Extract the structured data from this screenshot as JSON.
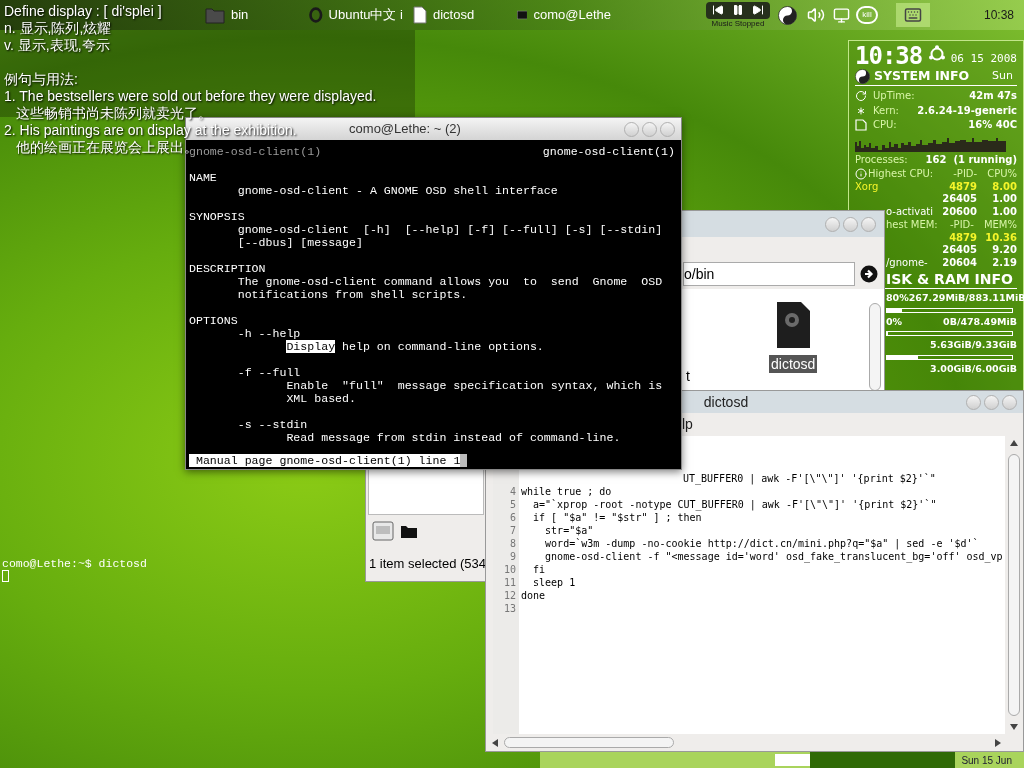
{
  "top_panel": {
    "tasks": [
      {
        "kind": "folder",
        "label": "bin"
      },
      {
        "kind": "browser",
        "label": "Ubuntu中文 i"
      },
      {
        "kind": "document",
        "label": "dictosd"
      },
      {
        "kind": "terminal",
        "label": "como@Lethe"
      }
    ],
    "media_status": "Music Stopped",
    "kill_label": "kill",
    "clock": "10:38"
  },
  "osd": {
    "title": "Define display : [ di'splei ]",
    "senses": [
      "n. 显示,陈列,炫耀",
      "v. 显示,表现,夸示"
    ],
    "examples_heading": "例句与用法:",
    "examples": [
      {
        "en": "1. The bestsellers were sold out before they were displayed.",
        "zh": "这些畅销书尚未陈列就卖光了。"
      },
      {
        "en": "2. His paintings are on display at the exhibition.",
        "zh": "他的绘画正在展览会上展出。"
      }
    ]
  },
  "conky": {
    "time": "10:38",
    "date": "06 15 2008",
    "title": "SYSTEM INFO",
    "day": "Sun",
    "stats": [
      {
        "kind": "uptime",
        "label": "UpTime:",
        "value": "42m 47s"
      },
      {
        "kind": "kernel",
        "label": "Kern:",
        "value": "2.6.24-19-generic"
      },
      {
        "kind": "cpu",
        "label": "CPU:",
        "value": "16% 40C"
      }
    ],
    "processes_label": "Processes:",
    "processes_value": "162  (1 running)",
    "cpu_table": {
      "kind": "full",
      "heading": "Highest CPU:",
      "columns": [
        "-PID-",
        "CPU%"
      ],
      "rows": [
        {
          "kind": "full",
          "name": "Xorg",
          "pid": "4879",
          "value": "8.00",
          "color": "#f5f52a"
        },
        {
          "kind": "partial",
          "pid": "26405",
          "value": "1.00",
          "color": "#ffffff"
        },
        {
          "kind": "partial",
          "name": "o-activati",
          "pid": "20600",
          "value": "1.00",
          "color": "#ffffff"
        }
      ]
    },
    "mem_table": {
      "kind": "partial",
      "heading": "hest MEM:",
      "columns": [
        "-PID-",
        "MEM%"
      ],
      "rows": [
        {
          "kind": "partial",
          "pid": "4879",
          "value": "10.36",
          "color": "#f5f52a"
        },
        {
          "kind": "partial",
          "pid": "26405",
          "value": "9.20",
          "color": "#ffffff"
        },
        {
          "kind": "partial",
          "name": "/gnome-",
          "pid": "20604",
          "value": "2.19",
          "color": "#ffffff"
        }
      ]
    },
    "disk_title": "ISK & RAM INFO",
    "disks": [
      {
        "label": "80%",
        "value": "267.29MiB/883.11MiB",
        "level": 0.12
      },
      {
        "label": "0%",
        "value": "0B/478.49MiB",
        "level": 0
      },
      {
        "value": "5.63GiB/9.33GiB",
        "level": 0.25
      },
      {
        "value": "3.00GiB/6.00GiB"
      }
    ]
  },
  "terminal_window": {
    "title": "como@Lethe: ~ (2)",
    "header_left": "gnome-osd-client(1)",
    "header_right": "gnome-osd-client(1)",
    "sections": [
      {
        "heading": "NAME",
        "lines": [
          "gnome-osd-client - A GNOME OSD shell interface"
        ]
      },
      {
        "heading": "SYNOPSIS",
        "lines": [
          "gnome-osd-client  [-h]  [--help] [-f] [--full] [-s] [--stdin]",
          "[--dbus] [message]"
        ]
      },
      {
        "heading": "DESCRIPTION",
        "lines": [
          "The gnome-osd-client command allows you  to  send  Gnome  OSD",
          "notifications from shell scripts."
        ]
      }
    ],
    "options_heading": "OPTIONS",
    "options": [
      {
        "flag": "-h --help",
        "lines": [
          [
            {
              "text": "Display",
              "highlighted": true
            },
            {
              "text": " help on command-line options.",
              "highlighted": false
            }
          ]
        ]
      },
      {
        "flag": "-f --full",
        "lines": [
          [
            {
              "text": "Enable  \"full\"  message specification syntax, which is",
              "highlighted": false
            }
          ],
          [
            {
              "text": "XML based.",
              "highlighted": false
            }
          ]
        ]
      },
      {
        "flag": "-s --stdin",
        "lines": [
          [
            {
              "text": "Read message from stdin instead of command-line.",
              "highlighted": false
            }
          ]
        ]
      }
    ],
    "status": "Manual page gnome-osd-client(1) line 1"
  },
  "file_manager": {
    "location_fragment": "o/bin",
    "files": [
      {
        "kind": "clipped",
        "label": "t",
        "selected": false
      },
      {
        "kind": "script",
        "label": "dictosd",
        "selected": true
      }
    ],
    "status": "1 item selected (534"
  },
  "editor": {
    "title": "dictosd",
    "menu_fragment": "lp",
    "lines": [
      {
        "kind": "partial",
        "text": "UT_BUFFER0 | awk -F'[\\\"\\\"]' '{print $2}'`\""
      },
      {
        "kind": "full",
        "number": "4",
        "text": "while true ; do"
      },
      {
        "kind": "full",
        "number": "5",
        "text": "  a=\"`xprop -root -notype CUT_BUFFER0 | awk -F'[\\\"\\\"]' '{print $2}'`\""
      },
      {
        "kind": "full",
        "number": "6",
        "text": "  if [ \"$a\" != \"$str\" ] ; then"
      },
      {
        "kind": "full",
        "number": "7",
        "text": "    str=\"$a\""
      },
      {
        "kind": "full",
        "number": "8",
        "text": "    word=`w3m -dump -no-cookie http://dict.cn/mini.php?q=\"$a\" | sed -e '$d'`"
      },
      {
        "kind": "full",
        "number": "9",
        "text": "    gnome-osd-client -f \"<message id='word' osd_fake_translucent_bg='off' osd_vp"
      },
      {
        "kind": "full",
        "number": "10",
        "text": "  fi"
      },
      {
        "kind": "full",
        "number": "11",
        "text": "  sleep 1"
      },
      {
        "kind": "full",
        "number": "12",
        "text": "done"
      },
      {
        "number": "13"
      }
    ]
  },
  "desktop_console": {
    "prompt": "como@Lethe:~$ dictosd"
  },
  "dock": {
    "date": "Sun 15 Jun"
  }
}
